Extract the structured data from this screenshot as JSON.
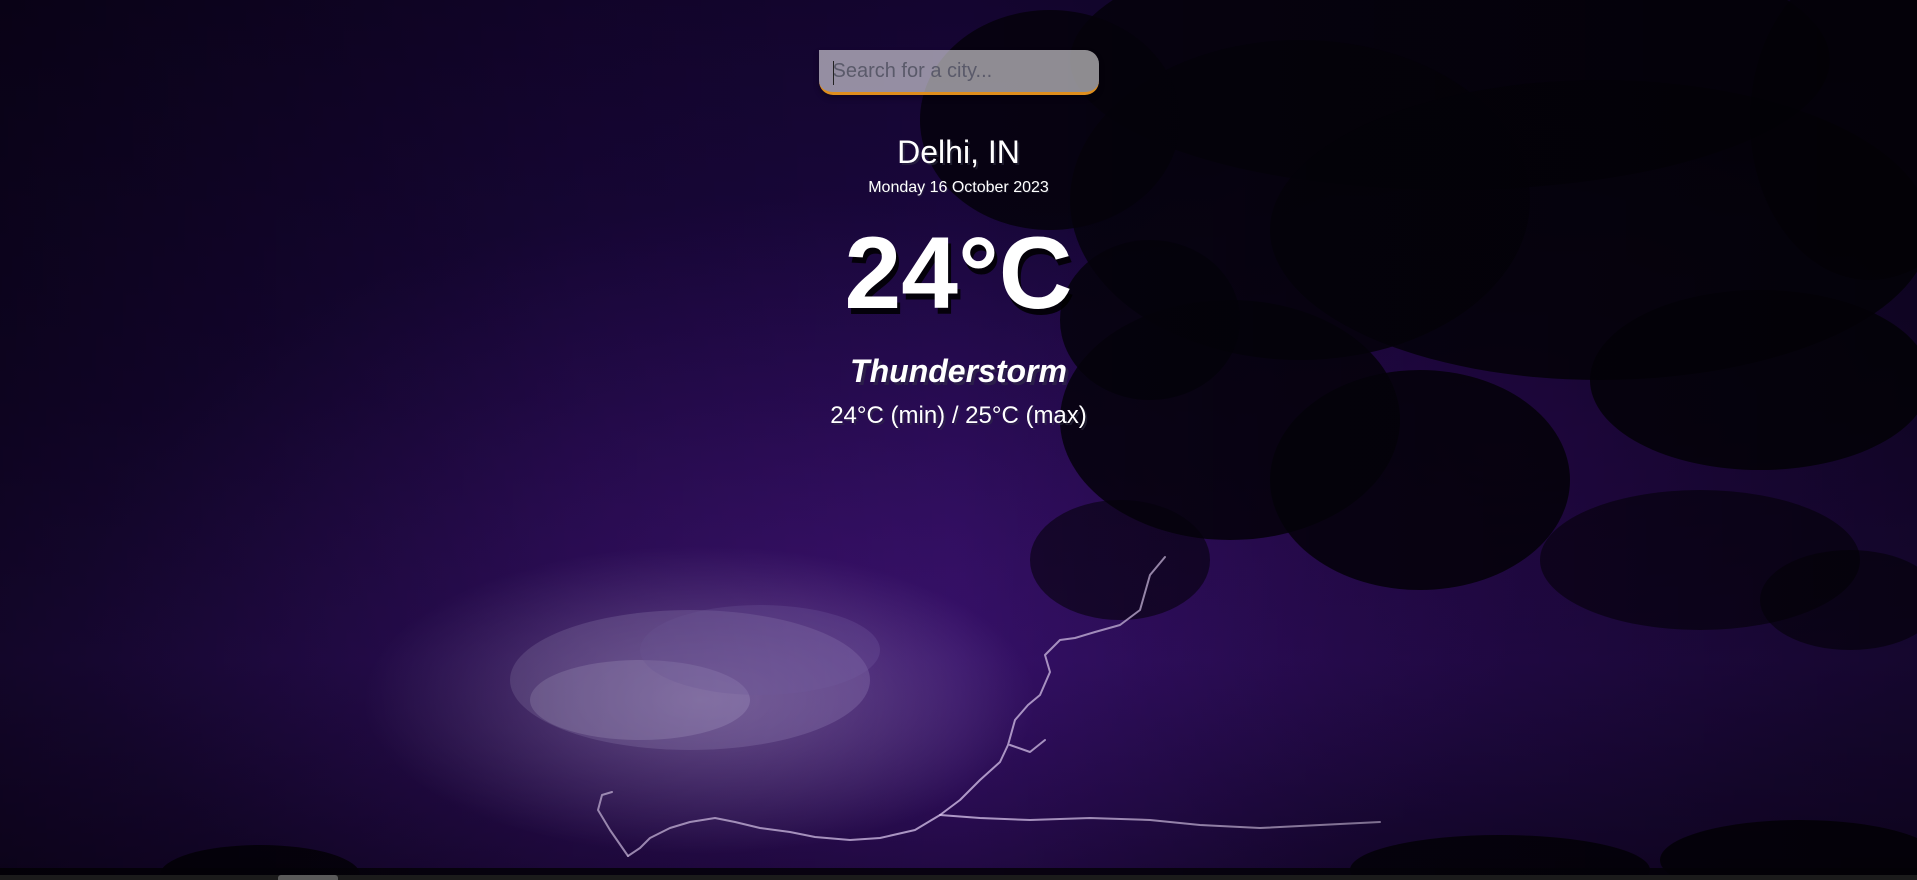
{
  "search": {
    "placeholder": "Search for a city...",
    "value": ""
  },
  "location": {
    "city": "Delhi, IN",
    "date": "Monday 16 October 2023"
  },
  "current": {
    "temperature": "24°C",
    "condition": "Thunderstorm",
    "hilow": "24°C (min) / 25°C (max)"
  },
  "colors": {
    "accent": "#df8e1d",
    "background": "#1d0845",
    "text": "#ffffff"
  },
  "icons": {
    "background": "thunderstorm-background-image"
  }
}
